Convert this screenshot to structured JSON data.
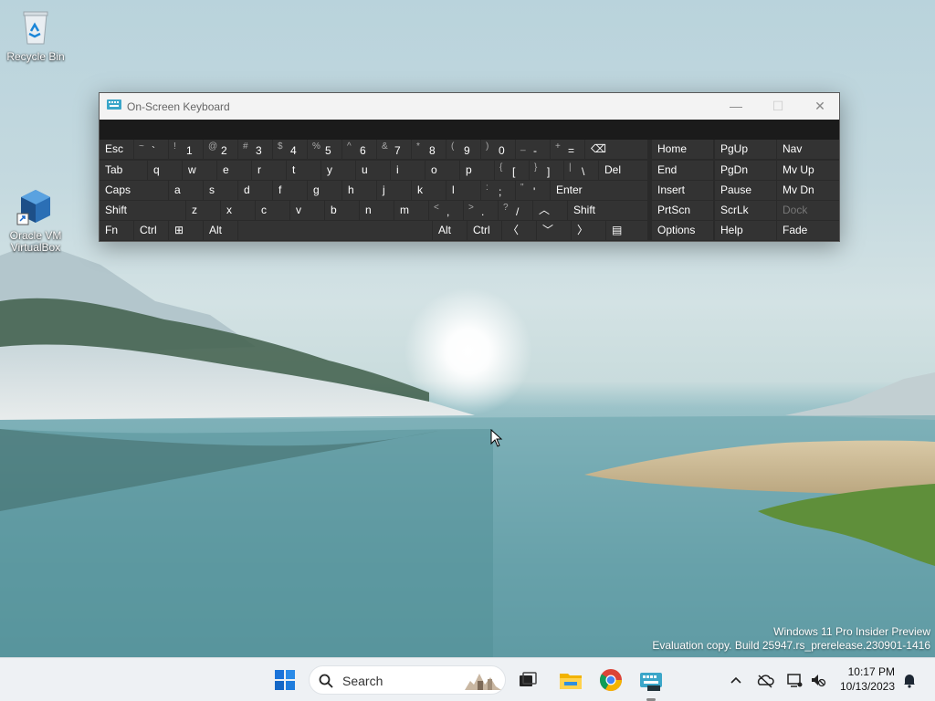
{
  "desktop": {
    "icons": [
      {
        "label": "Recycle Bin",
        "icon": "recycle-bin-icon"
      },
      {
        "label": "Oracle VM VirtualBox",
        "icon": "virtualbox-icon"
      }
    ]
  },
  "osk": {
    "title": "On-Screen Keyboard",
    "controls": {
      "minimize": "—",
      "maximize": "☐",
      "close": "✕"
    },
    "rows": {
      "r1": [
        {
          "main": "Esc"
        },
        {
          "alt": "~",
          "main": "`"
        },
        {
          "alt": "!",
          "main": "1"
        },
        {
          "alt": "@",
          "main": "2"
        },
        {
          "alt": "#",
          "main": "3"
        },
        {
          "alt": "$",
          "main": "4"
        },
        {
          "alt": "%",
          "main": "5"
        },
        {
          "alt": "^",
          "main": "6"
        },
        {
          "alt": "&",
          "main": "7"
        },
        {
          "alt": "*",
          "main": "8"
        },
        {
          "alt": "(",
          "main": "9"
        },
        {
          "alt": ")",
          "main": "0"
        },
        {
          "alt": "_",
          "main": "-"
        },
        {
          "alt": "+",
          "main": "="
        },
        {
          "main": "⌫"
        }
      ],
      "r2": [
        {
          "main": "Tab"
        },
        {
          "main": "q"
        },
        {
          "main": "w"
        },
        {
          "main": "e"
        },
        {
          "main": "r"
        },
        {
          "main": "t"
        },
        {
          "main": "y"
        },
        {
          "main": "u"
        },
        {
          "main": "i"
        },
        {
          "main": "o"
        },
        {
          "main": "p"
        },
        {
          "alt": "{",
          "main": "["
        },
        {
          "alt": "}",
          "main": "]"
        },
        {
          "alt": "|",
          "main": "\\"
        },
        {
          "main": "Del"
        }
      ],
      "r3": [
        {
          "main": "Caps"
        },
        {
          "main": "a"
        },
        {
          "main": "s"
        },
        {
          "main": "d"
        },
        {
          "main": "f"
        },
        {
          "main": "g"
        },
        {
          "main": "h"
        },
        {
          "main": "j"
        },
        {
          "main": "k"
        },
        {
          "main": "l"
        },
        {
          "alt": ":",
          "main": ";"
        },
        {
          "alt": "\"",
          "main": "'"
        },
        {
          "main": "Enter"
        }
      ],
      "r4": [
        {
          "main": "Shift"
        },
        {
          "main": "z"
        },
        {
          "main": "x"
        },
        {
          "main": "c"
        },
        {
          "main": "v"
        },
        {
          "main": "b"
        },
        {
          "main": "n"
        },
        {
          "main": "m"
        },
        {
          "alt": "<",
          "main": ","
        },
        {
          "alt": ">",
          "main": "."
        },
        {
          "alt": "?",
          "main": "/"
        },
        {
          "main": "︿"
        },
        {
          "main": "Shift"
        }
      ],
      "r5": [
        {
          "main": "Fn"
        },
        {
          "main": "Ctrl"
        },
        {
          "main": "⊞"
        },
        {
          "main": "Alt"
        },
        {
          "main": ""
        },
        {
          "main": "Alt"
        },
        {
          "main": "Ctrl"
        },
        {
          "main": "〈"
        },
        {
          "main": "﹀"
        },
        {
          "main": "〉"
        },
        {
          "main": "▤"
        }
      ]
    },
    "nav": [
      [
        "Home",
        "PgUp",
        "Nav"
      ],
      [
        "End",
        "PgDn",
        "Mv Up"
      ],
      [
        "Insert",
        "Pause",
        "Mv Dn"
      ],
      [
        "PrtScn",
        "ScrLk",
        "Dock"
      ],
      [
        "Options",
        "Help",
        "Fade"
      ]
    ]
  },
  "watermark": {
    "line1": "Windows 11 Pro Insider Preview",
    "line2": "Evaluation copy. Build 25947.rs_prerelease.230901-1416"
  },
  "taskbar": {
    "search_label": "Search",
    "apps": [
      "start-icon",
      "task-view-icon",
      "file-explorer-icon",
      "chrome-icon",
      "osk-app-icon"
    ],
    "clock": {
      "time": "10:17 PM",
      "date": "10/13/2023"
    }
  },
  "colors": {
    "key_bg": "#333333",
    "osk_bg": "#2a2a2a",
    "taskbar_bg": "#eef1f4",
    "accent": "#0067c0"
  }
}
